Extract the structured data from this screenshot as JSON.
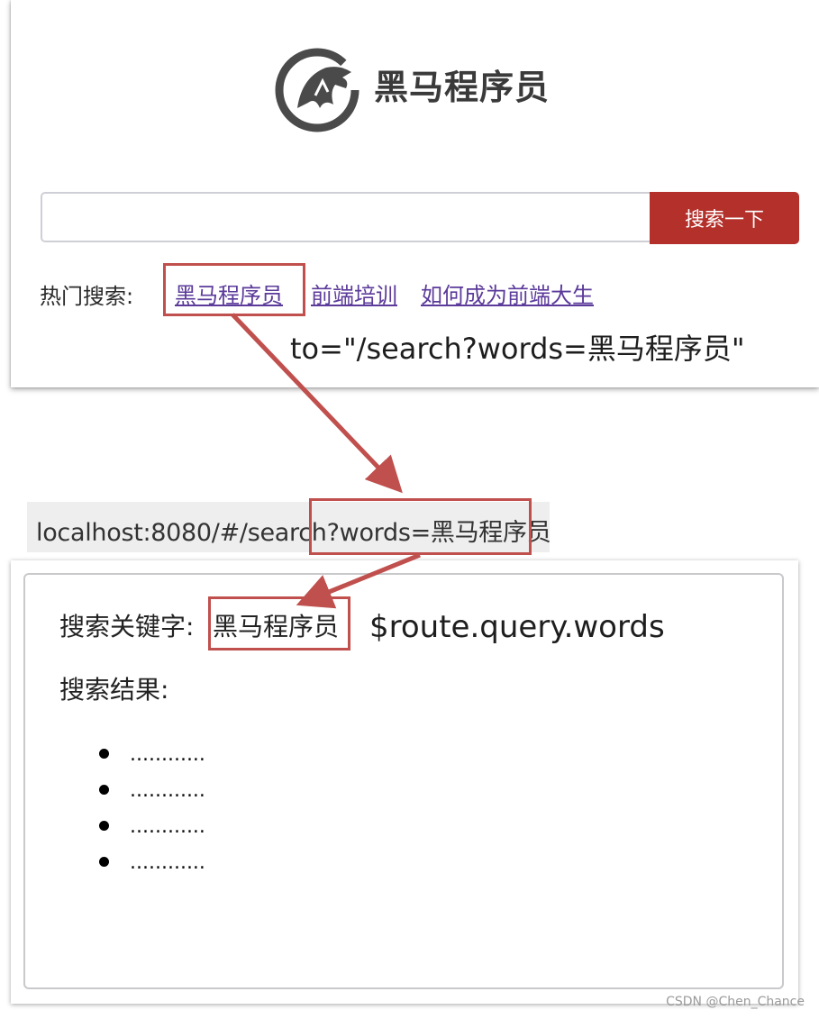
{
  "search_page": {
    "logo_text": "黑马程序员",
    "search_input": {
      "value": "",
      "placeholder": ""
    },
    "search_button_label": "搜索一下",
    "hot_search_label": "热门搜索:",
    "hot_links": [
      "黑马程序员",
      "前端培训",
      "如何成为前端大生"
    ]
  },
  "annotations": {
    "router_link_to": "to=\"/search?words=黑马程序员\"",
    "route_query": "$route.query.words"
  },
  "url_bar": {
    "host_prefix": "localhost:8080/#/search",
    "query": "?words=黑马程序员"
  },
  "result_page": {
    "keyword_label": "搜索关键字:",
    "keyword_value": "黑马程序员",
    "results_label": "搜索结果:",
    "results": [
      "............",
      "............",
      "............",
      "............"
    ]
  },
  "watermark": "CSDN @Chen_Chance",
  "colors": {
    "accent_red": "#b3302b",
    "highlight_box": "#c0504d",
    "link_purple": "#5b3a9a"
  }
}
